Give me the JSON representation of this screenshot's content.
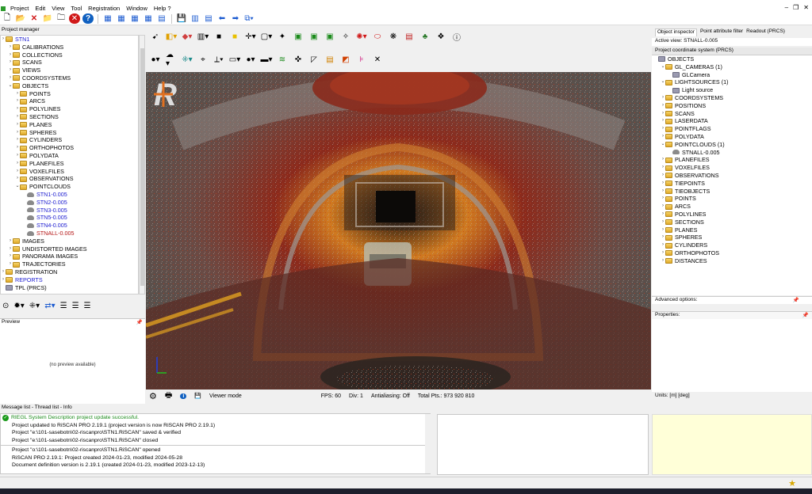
{
  "menu": [
    "Project",
    "Edit",
    "View",
    "Tool",
    "Registration",
    "Window",
    "Help ?"
  ],
  "project_manager": {
    "header": "Project manager",
    "items": [
      {
        "label": "STN1",
        "depth": 0,
        "kind": "root",
        "cls": "blue"
      },
      {
        "label": "CALIBRATIONS",
        "depth": 1,
        "kind": "folder"
      },
      {
        "label": "COLLECTIONS",
        "depth": 1,
        "kind": "folder"
      },
      {
        "label": "SCANS",
        "depth": 1,
        "kind": "folder"
      },
      {
        "label": "VIEWS",
        "depth": 1,
        "kind": "folder"
      },
      {
        "label": "COORDSYSTEMS",
        "depth": 1,
        "kind": "folder"
      },
      {
        "label": "OBJECTS",
        "depth": 1,
        "kind": "folder",
        "open": true
      },
      {
        "label": "POINTS",
        "depth": 2,
        "kind": "folder"
      },
      {
        "label": "ARCS",
        "depth": 2,
        "kind": "folder"
      },
      {
        "label": "POLYLINES",
        "depth": 2,
        "kind": "folder"
      },
      {
        "label": "SECTIONS",
        "depth": 2,
        "kind": "folder"
      },
      {
        "label": "PLANES",
        "depth": 2,
        "kind": "folder"
      },
      {
        "label": "SPHERES",
        "depth": 2,
        "kind": "folder"
      },
      {
        "label": "CYLINDERS",
        "depth": 2,
        "kind": "folder"
      },
      {
        "label": "ORTHOPHOTOS",
        "depth": 2,
        "kind": "folder"
      },
      {
        "label": "POLYDATA",
        "depth": 2,
        "kind": "folder"
      },
      {
        "label": "PLANEFILES",
        "depth": 2,
        "kind": "folder"
      },
      {
        "label": "VOXELFILES",
        "depth": 2,
        "kind": "folder"
      },
      {
        "label": "OBSERVATIONS",
        "depth": 2,
        "kind": "folder"
      },
      {
        "label": "POINTCLOUDS",
        "depth": 2,
        "kind": "folder",
        "open": true
      },
      {
        "label": "STN1-0.005",
        "depth": 3,
        "kind": "cloud",
        "cls": "blue"
      },
      {
        "label": "STN2-0.005",
        "depth": 3,
        "kind": "cloud",
        "cls": "blue"
      },
      {
        "label": "STN3-0.005",
        "depth": 3,
        "kind": "cloud",
        "cls": "blue"
      },
      {
        "label": "STN5-0.005",
        "depth": 3,
        "kind": "cloud",
        "cls": "blue"
      },
      {
        "label": "STN4-0.005",
        "depth": 3,
        "kind": "cloud",
        "cls": "blue"
      },
      {
        "label": "STNALL-0.005",
        "depth": 3,
        "kind": "cloud",
        "cls": "red"
      },
      {
        "label": "IMAGES",
        "depth": 1,
        "kind": "folder"
      },
      {
        "label": "UNDISTORTED IMAGES",
        "depth": 1,
        "kind": "folder"
      },
      {
        "label": "PANORAMA IMAGES",
        "depth": 1,
        "kind": "folder"
      },
      {
        "label": "TRAJECTORIES",
        "depth": 1,
        "kind": "folder"
      },
      {
        "label": "REGISTRATION",
        "depth": 0,
        "kind": "folder"
      },
      {
        "label": "REPORTS",
        "depth": 0,
        "kind": "folder",
        "cls": "blue"
      },
      {
        "label": "TPL (PRCS)",
        "depth": 0,
        "kind": "plain"
      }
    ]
  },
  "preview": {
    "header": "Preview",
    "empty_text": "(no preview available)"
  },
  "viewer": {
    "mode": "Viewer mode",
    "fps": "FPS: 60",
    "div": "Div: 1",
    "antialiasing": "Antialiasing: Off",
    "total_pts": "Total Pts.: 973 920 810",
    "logo": "R"
  },
  "inspector": {
    "tabs": [
      "Object inspector",
      "Point attribute filter",
      "Readout (PRCS)"
    ],
    "active_view": "Active view: STNALL-0.005",
    "pcs_header": "Project coordinate system (PRCS)",
    "items": [
      {
        "label": "OBJECTS",
        "depth": 0,
        "kind": "plain"
      },
      {
        "label": "GL_CAMERAS (1)",
        "depth": 1,
        "kind": "folder",
        "open": true
      },
      {
        "label": "GLCamera",
        "depth": 2,
        "kind": "plain"
      },
      {
        "label": "LIGHTSOURCES (1)",
        "depth": 1,
        "kind": "folder",
        "open": true
      },
      {
        "label": "Light source",
        "depth": 2,
        "kind": "plain"
      },
      {
        "label": "COORDSYSTEMS",
        "depth": 1,
        "kind": "folder"
      },
      {
        "label": "POSITIONS",
        "depth": 1,
        "kind": "folder"
      },
      {
        "label": "SCANS",
        "depth": 1,
        "kind": "folder"
      },
      {
        "label": "LASERDATA",
        "depth": 1,
        "kind": "folder"
      },
      {
        "label": "POINTFLAGS",
        "depth": 1,
        "kind": "folder"
      },
      {
        "label": "POLYDATA",
        "depth": 1,
        "kind": "folder"
      },
      {
        "label": "POINTCLOUDS (1)",
        "depth": 1,
        "kind": "folder",
        "open": true
      },
      {
        "label": "STNALL-0.005",
        "depth": 2,
        "kind": "cloud"
      },
      {
        "label": "PLANEFILES",
        "depth": 1,
        "kind": "folder"
      },
      {
        "label": "VOXELFILES",
        "depth": 1,
        "kind": "folder"
      },
      {
        "label": "OBSERVATIONS",
        "depth": 1,
        "kind": "folder"
      },
      {
        "label": "TIEPOINTS",
        "depth": 1,
        "kind": "folder"
      },
      {
        "label": "TIEOBJECTS",
        "depth": 1,
        "kind": "folder"
      },
      {
        "label": "POINTS",
        "depth": 1,
        "kind": "folder"
      },
      {
        "label": "ARCS",
        "depth": 1,
        "kind": "folder"
      },
      {
        "label": "POLYLINES",
        "depth": 1,
        "kind": "folder"
      },
      {
        "label": "SECTIONS",
        "depth": 1,
        "kind": "folder"
      },
      {
        "label": "PLANES",
        "depth": 1,
        "kind": "folder"
      },
      {
        "label": "SPHERES",
        "depth": 1,
        "kind": "folder"
      },
      {
        "label": "CYLINDERS",
        "depth": 1,
        "kind": "folder"
      },
      {
        "label": "ORTHOPHOTOS",
        "depth": 1,
        "kind": "folder"
      },
      {
        "label": "DISTANCES",
        "depth": 1,
        "kind": "folder"
      }
    ],
    "advanced_options": "Advanced options:",
    "properties": "Properties:",
    "units": "Units: [m] [deg]"
  },
  "messages": {
    "header": "Message list - Thread list - Info",
    "lines": [
      "RIEGL System Description project update successful.",
      "Project updated to RiSCAN PRO 2.19.1 (project version is now RiSCAN PRO 2.19.1)",
      "Project \"e:\\101-sasebotn\\02-riscanpro\\STN1.RiSCAN\" saved & verified",
      "Project \"e:\\101-sasebotn\\02-riscanpro\\STN1.RiSCAN\" closed",
      "Project \"o:\\101-sasebotn\\02-riscanpro\\STN1.RiSCAN\" opened",
      "RiSCAN PRO 2.19.1: Project created 2024-01-23, modified 2024-05-28",
      "Document definition version is 2.19.1 (created 2024-01-23, modified 2023-12-13)"
    ]
  }
}
